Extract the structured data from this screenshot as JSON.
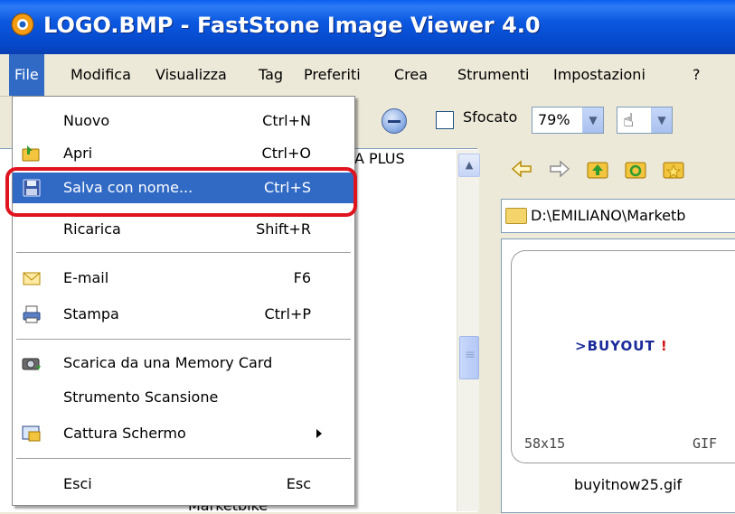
{
  "window": {
    "title": "LOGO.BMP  -  FastStone Image Viewer 4.0",
    "icon": "faststone-camera-icon"
  },
  "menubar": {
    "items": [
      "File",
      "Modifica",
      "Visualizza",
      "Tag",
      "Preferiti",
      "Crea",
      "Strumenti",
      "Impostazioni",
      "?"
    ],
    "active": "File"
  },
  "toolbar": {
    "checkbox_label": "Sfocato",
    "checkbox_checked": false,
    "zoom_value": "79%",
    "pan_tool": "hand-icon"
  },
  "file_menu": {
    "items": [
      {
        "label": "Nuovo",
        "shortcut": "Ctrl+N",
        "icon": ""
      },
      {
        "label": "Apri",
        "shortcut": "Ctrl+O",
        "icon": "open-folder-icon"
      },
      {
        "label": "Salva con nome...",
        "shortcut": "Ctrl+S",
        "icon": "floppy-disk-icon",
        "selected": true
      },
      {
        "label": "Ricarica",
        "shortcut": "Shift+R",
        "icon": ""
      },
      {
        "label": "E-mail",
        "shortcut": "F6",
        "icon": "envelope-icon"
      },
      {
        "label": "Stampa",
        "shortcut": "Ctrl+P",
        "icon": "printer-icon"
      },
      {
        "label": "Scarica da una Memory Card",
        "shortcut": "",
        "icon": "camera-download-icon"
      },
      {
        "label": "Strumento Scansione",
        "shortcut": "",
        "icon": ""
      },
      {
        "label": "Cattura Schermo",
        "shortcut": "",
        "icon": "screen-capture-icon",
        "submenu": true
      },
      {
        "label": "Esci",
        "shortcut": "Esc",
        "icon": ""
      }
    ],
    "highlight_color": "#e0141e",
    "selection_color": "#316ac5"
  },
  "tree": {
    "partial_label": "A PLUS",
    "last_item": "Marketbike"
  },
  "browser": {
    "nav_icons": [
      "back-arrow-icon",
      "forward-arrow-icon",
      "up-folder-icon",
      "refresh-folder-icon",
      "favorites-folder-icon"
    ],
    "path": "D:\\EMILIANO\\Marketb",
    "thumbnail": {
      "preview_text": ">BUYOUT !",
      "dimensions": "58x15",
      "type": "GIF",
      "filename": "buyitnow25.gif"
    }
  }
}
